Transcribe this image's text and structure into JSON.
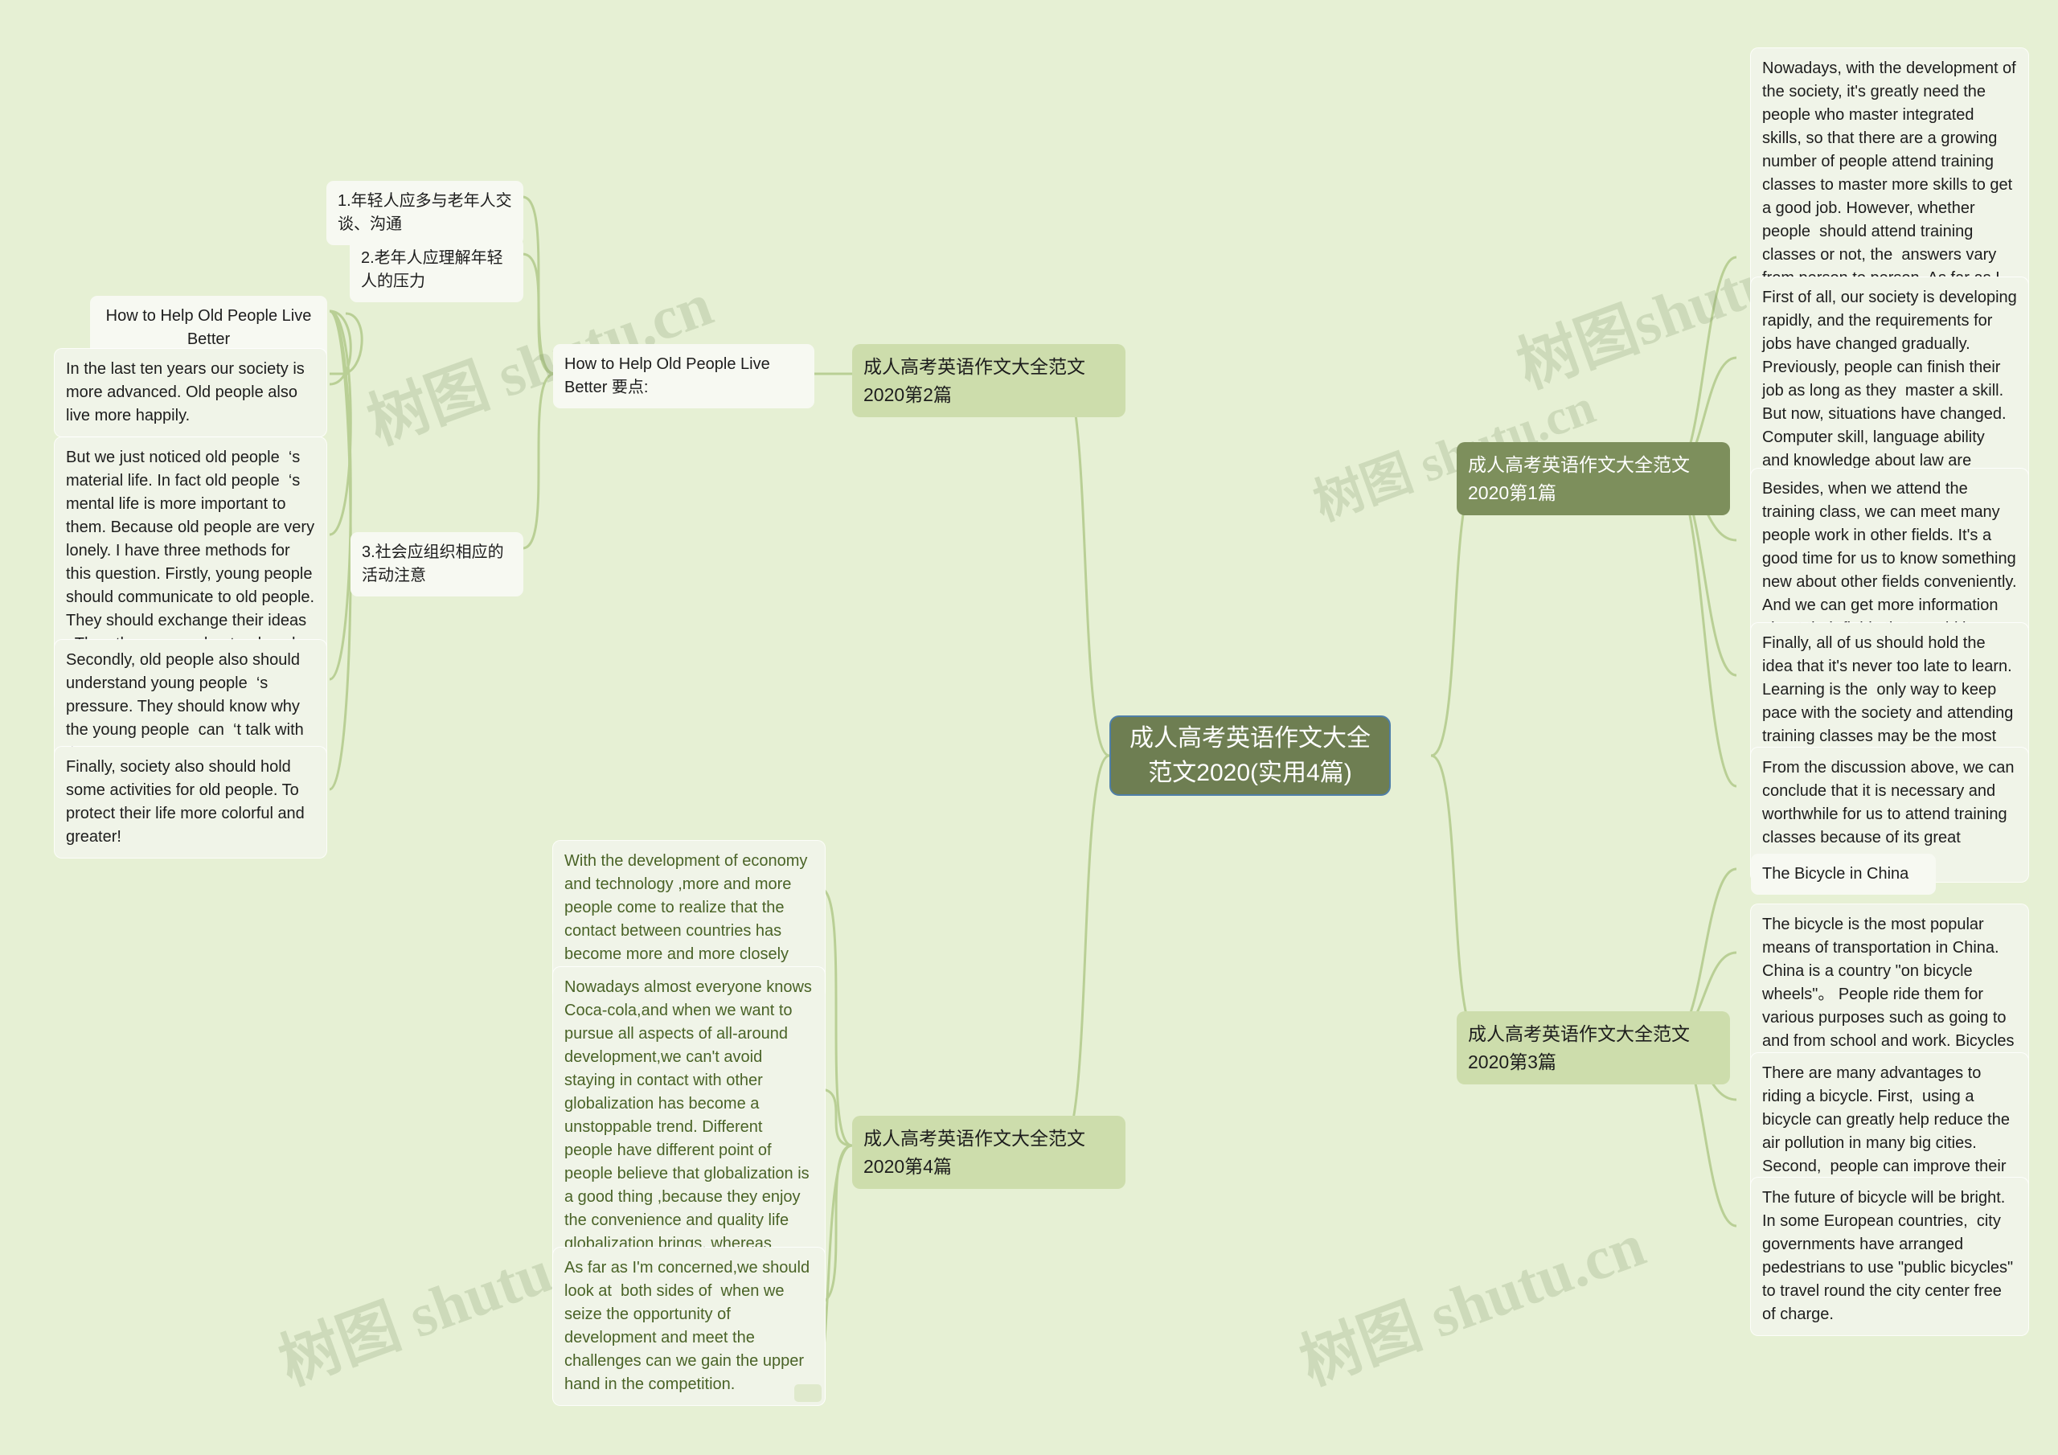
{
  "meta": {
    "background_color": "#e6f0d4",
    "root_color": "#6e7e52",
    "topic_color": "#cdddac",
    "topic_dark_color": "#7d8f5c",
    "leaf_color": "#f0f4e8",
    "branch4_text_color": "#4a6327"
  },
  "watermark": {
    "text_1": "树图 shutu.cn",
    "text_2": "树图shutu.cn",
    "text_3": "树图 shutu.cn",
    "text_4": "树图 shutu.cn",
    "text_5": "树图 shutu.cn"
  },
  "root": {
    "label": "成人高考英语作文大全范文2020(实用4篇)"
  },
  "branches": {
    "essay1": {
      "label": "成人高考英语作文大全范文2020第1篇",
      "paragraphs": [
        "Nowadays, with the development of the society, it's greatly need the people who master integrated skills, so that there are a growing number of people attend training classes to master more skills to get a good job. However, whether people  should attend training classes or not, the  answers vary from person to person. As far as I am concerned, it is necessary to attend training classes for the following reasons.",
        "First of all, our society is developing rapidly, and the requirements for jobs have changed gradually. Previously, people can finish their job as long as they  master a skill. But now, situations have changed. Computer skill, language ability  and knowledge about law are needed for an employee, which helps them go further in their career.",
        "Besides, when we attend the training class, we can meet many people work in other fields. It's a good time for us to know something new about other fields conveniently. And we can get more information about their fields that would be very helpful to our career.",
        "Finally, all of us should hold the idea that it's never too late to learn. Learning is the  only way to keep pace with the society and attending training classes may be the most effective way.",
        "From the discussion above, we can conclude that it is necessary and worthwhile for us to attend training classes because of its great importance."
      ]
    },
    "essay2": {
      "label": "成人高考英语作文大全范文2020第2篇",
      "outline_label": "How to Help Old People Live Better 要点:",
      "outline_points": [
        "1.年轻人应多与老年人交谈、沟通",
        "2.老年人应理解年轻人的压力",
        "3.社会应组织相应的活动注意"
      ],
      "title_card": "How to Help Old People Live Better",
      "paragraphs": [
        "In the last ten years our society is more advanced. Old people also live more happily.",
        "But we just noticed old people  ‘s material life. In fact old people  ‘s mental life is more important to them. Because old people are very lonely. I have three methods for this question. Firstly, young people should communicate to old people. They should exchange their ideas . Then they can understand each other more easily. The old people may be happier.",
        "Secondly, old people also should understand young people  ‘s pressure. They should know why the young people  can  ‘t talk with them.",
        "Finally, society also should hold some activities for old people. To protect their life more colorful and greater!"
      ]
    },
    "essay3": {
      "label": "成人高考英语作文大全范文2020第3篇",
      "title_card": "The Bicycle in China",
      "paragraphs": [
        "The bicycle is the most popular means of transportation in China. China is a country \"on bicycle wheels\"。 People ride them for various purposes such as going to and from school and work. Bicycles are very cheap and easy to buy in China.",
        "There are many advantages to riding a bicycle. First,  using a bicycle can greatly help reduce the air pollution in many big cities. Second,  people can improve their health by riding a bicycle.",
        "The future of bicycle will be bright. In some European countries,  city governments have arranged pedestrians to use \"public bicycles\" to travel round the city center free of charge."
      ]
    },
    "essay4": {
      "label": "成人高考英语作文大全范文2020第4篇",
      "paragraphs": [
        "With the development of economy and technology ,more and more people come to realize that the contact between countries has become more and more closely frequent.",
        "Nowadays almost everyone knows Coca-cola,and when we want to pursue all aspects of all-around development,we can't avoid staying in contact with other globalization has become a unstoppable trend. Different people have different point of  people believe that globalization is a good thing ,because they enjoy the convenience and quality life globalization brings, whereas others argue that the developed countries are the only beneficiaries of globalization, and the developing countries in the course of globalization suffered a series of environmental pollution problems.",
        "As far as I'm concerned,we should look at  both sides of  when we seize the opportunity of development and meet the challenges can we gain the upper hand in the competition."
      ]
    }
  }
}
